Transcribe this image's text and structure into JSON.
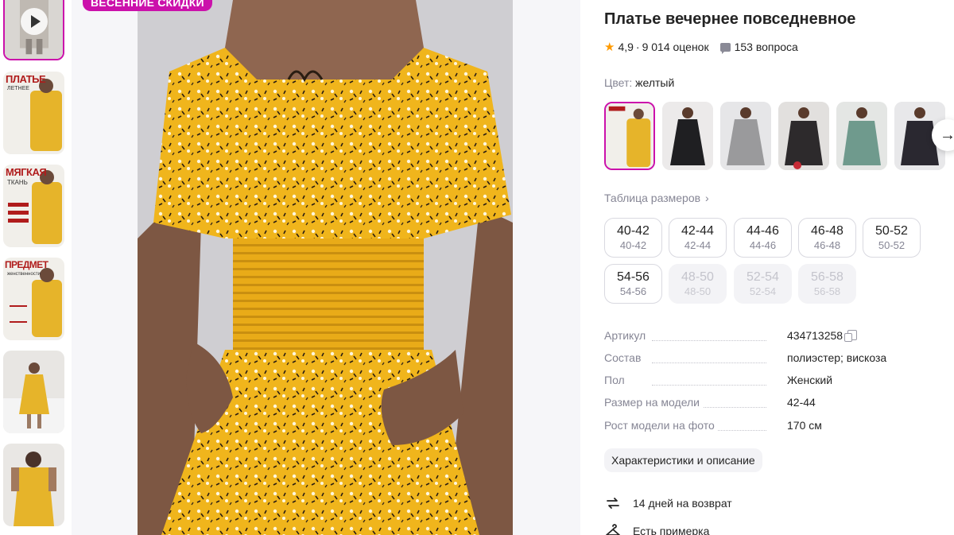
{
  "promo": {
    "badge": "ВЕСЕННИЕ СКИДКИ"
  },
  "thumbnails": [
    {
      "name": "video-thumb",
      "kind": "video"
    },
    {
      "name": "thumb-2",
      "headline": "ПЛАТЬЕ",
      "sub": "ЛЕТНЕЕ"
    },
    {
      "name": "thumb-3",
      "headline": "МЯГКАЯ",
      "sub": "ТКАНЬ"
    },
    {
      "name": "thumb-4",
      "headline": "ПРЕДМЕТ",
      "sub": "женственности"
    },
    {
      "name": "thumb-5"
    },
    {
      "name": "thumb-6"
    }
  ],
  "product": {
    "title": "Платье вечернее повседневное",
    "rating": "4,9",
    "rating_sep": "·",
    "reviews": "9 014 оценок",
    "questions": "153 вопроса"
  },
  "color": {
    "label": "Цвет:",
    "value": "желтый"
  },
  "swatch_colors": [
    "#e8b52a",
    "#1f1f22",
    "#9a9a9c",
    "#2d2a2c",
    "#6f9a8d",
    "#2a2830"
  ],
  "size_table": {
    "label": "Таблица размеров",
    "chevron": "›"
  },
  "sizes": [
    {
      "ru": "40-42",
      "alt": "40-42",
      "available": true
    },
    {
      "ru": "42-44",
      "alt": "42-44",
      "available": true
    },
    {
      "ru": "44-46",
      "alt": "44-46",
      "available": true
    },
    {
      "ru": "46-48",
      "alt": "46-48",
      "available": true
    },
    {
      "ru": "50-52",
      "alt": "50-52",
      "available": true
    },
    {
      "ru": "54-56",
      "alt": "54-56",
      "available": true
    },
    {
      "ru": "48-50",
      "alt": "48-50",
      "available": false
    },
    {
      "ru": "52-54",
      "alt": "52-54",
      "available": false
    },
    {
      "ru": "56-58",
      "alt": "56-58",
      "available": false
    }
  ],
  "specs": [
    {
      "key": "Артикул",
      "value": "434713258"
    },
    {
      "key": "Состав",
      "value": "полиэстер; вискоза"
    },
    {
      "key": "Пол",
      "value": "Женский"
    },
    {
      "key": "Размер на модели",
      "value": "42-44"
    },
    {
      "key": "Рост модели на фото",
      "value": "170 см"
    }
  ],
  "description_button": "Характеристики и описание",
  "features": [
    {
      "icon": "return-arrows-icon",
      "text": "14 дней на возврат"
    },
    {
      "icon": "hanger-icon",
      "text": "Есть примерка"
    }
  ],
  "arrow": "→",
  "star": "★"
}
